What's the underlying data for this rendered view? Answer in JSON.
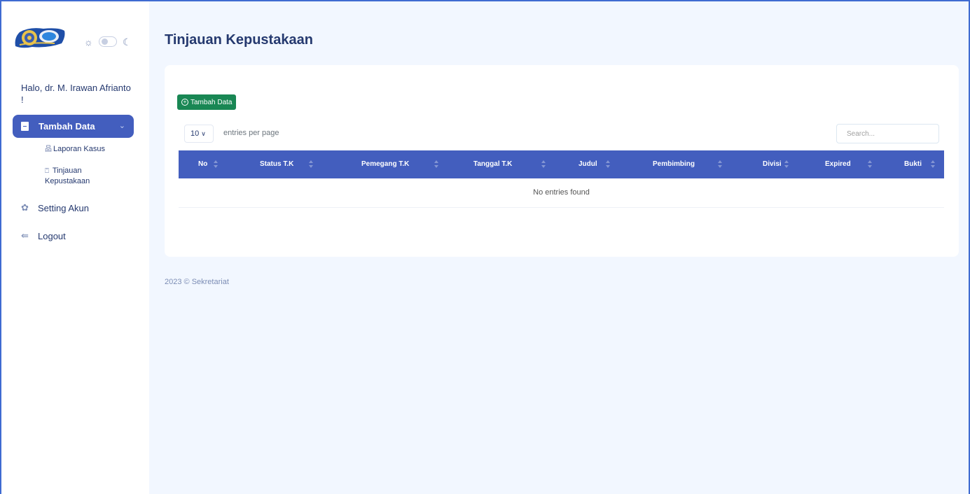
{
  "sidebar": {
    "greeting": "Halo, dr. M. Irawan Afrianto !",
    "active_menu": "Tambah Data",
    "submenu": [
      {
        "label": "Laporan Kasus",
        "icon": "sitemap-icon"
      },
      {
        "label": "Tinjauan Kepustakaan",
        "icon": "file-icon"
      }
    ],
    "items": [
      {
        "label": "Setting Akun",
        "icon": "gear-icon"
      },
      {
        "label": "Logout",
        "icon": "logout-icon"
      }
    ]
  },
  "main": {
    "title": "Tinjauan Kepustakaan",
    "add_button": "Tambah Data",
    "per_page_value": "10",
    "per_page_label": "entries per page",
    "search_placeholder": "Search...",
    "columns": [
      "No",
      "Status T.K",
      "Pemegang T.K",
      "Tanggal T.K",
      "Judul",
      "Pembimbing",
      "Divisi",
      "Expired",
      "Bukti"
    ],
    "empty_message": "No entries found"
  },
  "footer": {
    "text": "2023 © Sekretariat"
  },
  "colors": {
    "primary": "#435ebe",
    "success": "#198754",
    "background": "#f2f7ff"
  }
}
